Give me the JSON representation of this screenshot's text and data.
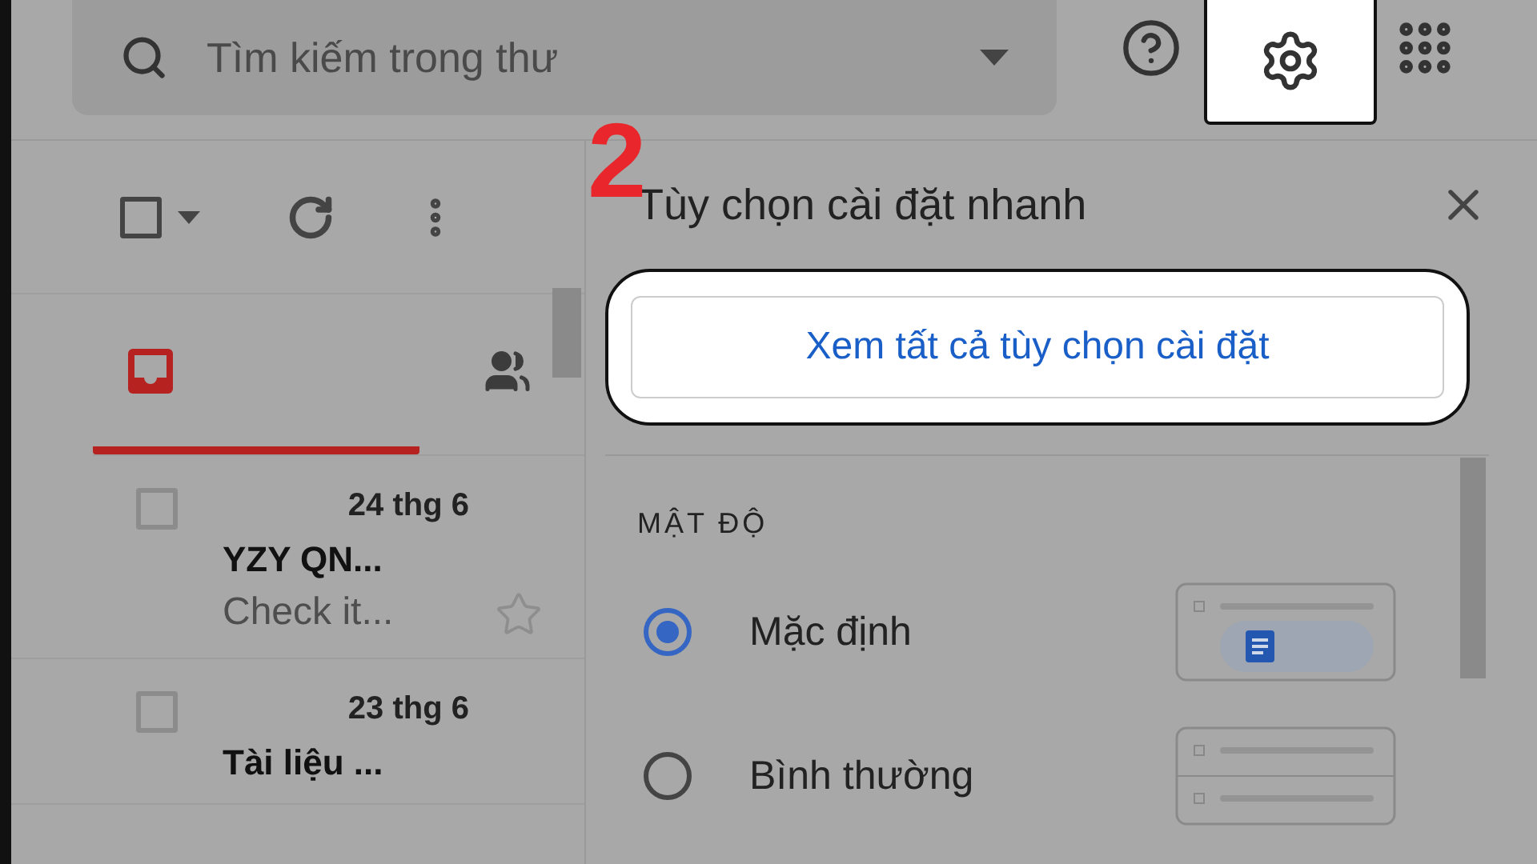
{
  "search": {
    "placeholder": "Tìm kiếm trong thư"
  },
  "annotation": "2",
  "select_all": {
    "checked": false
  },
  "tabs": [
    {
      "kind": "inbox",
      "selected": true
    },
    {
      "kind": "people",
      "selected": false
    }
  ],
  "mails": [
    {
      "checked": false,
      "date": "24 thg 6",
      "sender": "YZY QN...",
      "snippet": "Check it...",
      "starred": false
    },
    {
      "checked": false,
      "date": "23 thg 6",
      "sender": "Tài liệu ..."
    }
  ],
  "quick_settings": {
    "title": "Tùy chọn cài đặt nhanh",
    "all_settings_button": "Xem tất cả tùy chọn cài đặt",
    "section": "MẬT ĐỘ",
    "density_options": [
      {
        "kind": "default",
        "label": "Mặc định",
        "selected": true
      },
      {
        "kind": "comfortable",
        "label": "Bình thường",
        "selected": false
      }
    ]
  }
}
